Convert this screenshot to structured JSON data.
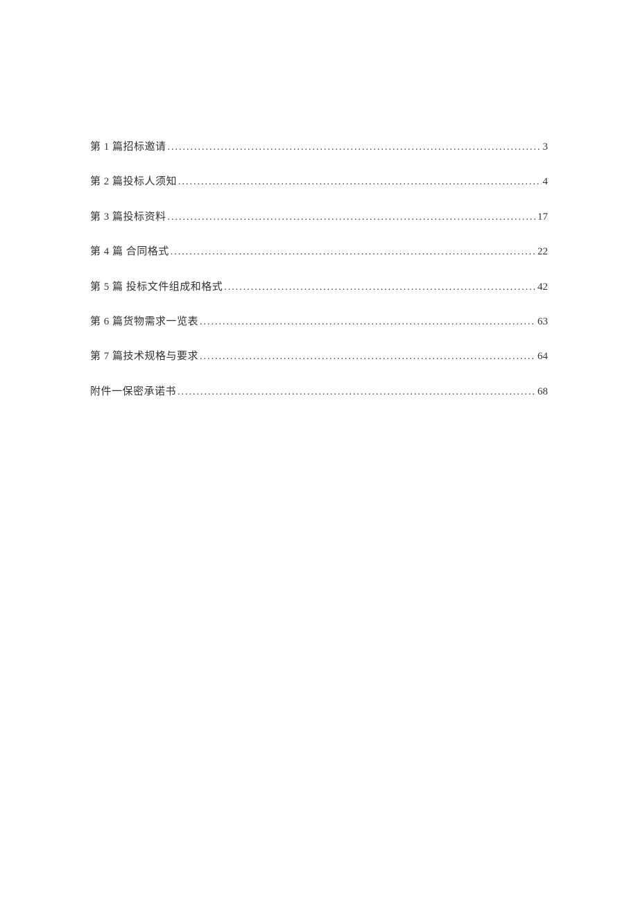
{
  "toc": [
    {
      "title": "第 1 篇招标邀请",
      "page": "3"
    },
    {
      "title": "第 2 篇投标人须知",
      "page": "4"
    },
    {
      "title": "第 3 篇投标资料",
      "page": "17"
    },
    {
      "title": "第 4 篇  合同格式",
      "page": "22"
    },
    {
      "title": "第 5 篇  投标文件组成和格式",
      "page": "42"
    },
    {
      "title": "第 6 篇货物需求一览表",
      "page": "63"
    },
    {
      "title": "第 7 篇技术规格与要求",
      "page": "64"
    },
    {
      "title": "附件一保密承诺书",
      "page": "68"
    }
  ]
}
